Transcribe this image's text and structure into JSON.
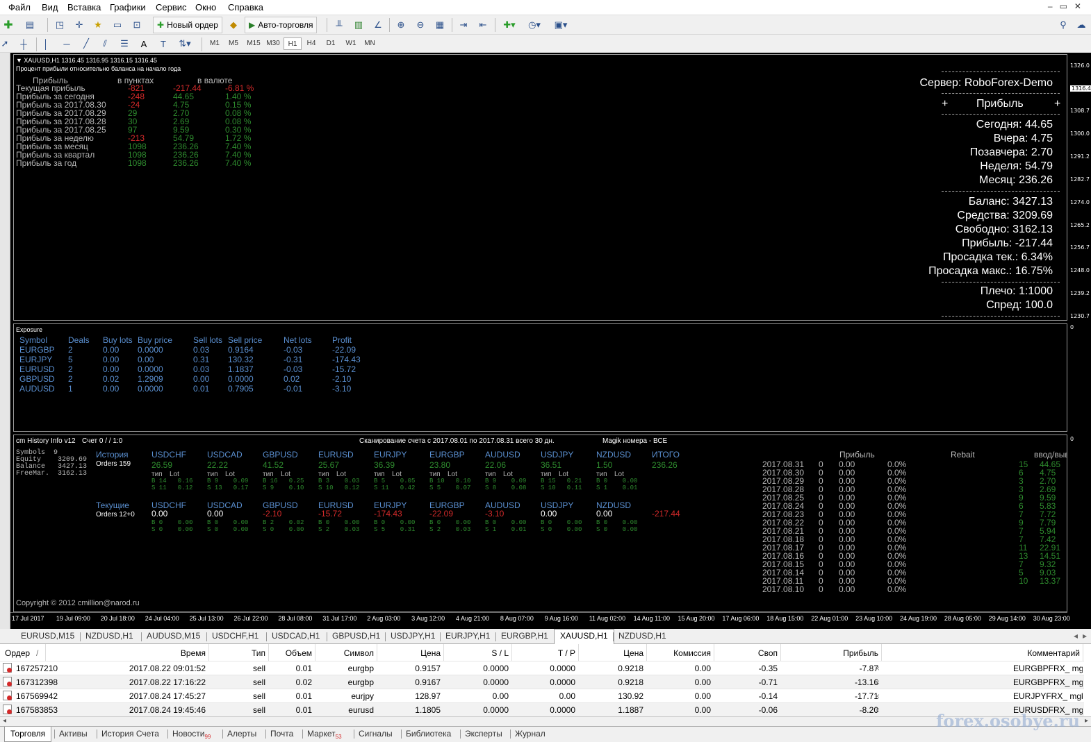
{
  "menu": [
    "Файл",
    "Вид",
    "Вставка",
    "Графики",
    "Сервис",
    "Окно",
    "Справка"
  ],
  "toolbar": {
    "new_order": "Новый ордер",
    "auto_trading": "Авто-торговля",
    "timeframes": [
      "M1",
      "M5",
      "M15",
      "M30",
      "H1",
      "H4",
      "D1",
      "W1",
      "MN"
    ],
    "active_timeframe": "H1"
  },
  "chart": {
    "header": "XAUUSD,H1  1316.45 1316.95 1316.15 1316.45",
    "subheader": "Процент прибыли относительно баланса на начало года",
    "profit_table": {
      "headers": [
        "Прибыль",
        "в пунктах",
        "в валюте"
      ],
      "rows": [
        {
          "label": "Текущая прибыль",
          "points": "-821",
          "money": "-217.44",
          "pct": "-6.81 %",
          "neg": true
        },
        {
          "label": "Прибыль за сегодня",
          "points": "-248",
          "money": "44.65",
          "pct": "1.40 %",
          "neg": false,
          "pneg": true
        },
        {
          "label": "Прибыль за 2017.08.30",
          "points": "-24",
          "money": "4.75",
          "pct": "0.15 %",
          "neg": false,
          "pneg": true
        },
        {
          "label": "Прибыль за 2017.08.29",
          "points": "29",
          "money": "2.70",
          "pct": "0.08 %",
          "neg": false
        },
        {
          "label": "Прибыль за 2017.08.28",
          "points": "30",
          "money": "2.69",
          "pct": "0.08 %",
          "neg": false
        },
        {
          "label": "Прибыль за 2017.08.25",
          "points": "97",
          "money": "9.59",
          "pct": "0.30 %",
          "neg": false
        },
        {
          "label": "Прибыль за неделю",
          "points": "-213",
          "money": "54.79",
          "pct": "1.72 %",
          "neg": false,
          "pneg": true
        },
        {
          "label": "Прибыль за месяц",
          "points": "1098",
          "money": "236.26",
          "pct": "7.40 %",
          "neg": false
        },
        {
          "label": "Прибыль за квартал",
          "points": "1098",
          "money": "236.26",
          "pct": "7.40 %",
          "neg": false
        },
        {
          "label": "Прибыль за год",
          "points": "1098",
          "money": "236.26",
          "pct": "7.40 %",
          "neg": false
        }
      ]
    },
    "right_panel": {
      "server": "Сервер: RoboForex-Demo",
      "profit_header": "Прибыль",
      "plus": "+",
      "lines1": [
        "Сегодня: 44.65",
        "Вчера: 4.75",
        "Позавчера: 2.70",
        "Неделя: 54.79",
        "Месяц: 236.26"
      ],
      "lines2": [
        "Баланс: 3427.13",
        "Средства: 3209.69",
        "Свободно: 3162.13",
        "Прибыль:  -217.44",
        "Просадка тек.:  6.34%",
        "Просадка макс.:  16.75%"
      ],
      "lines3": [
        "Плечо: 1:1000",
        "Спред: 100.0"
      ]
    },
    "price_ticks": [
      "1326.0",
      "1316.4",
      "1308.7",
      "1300.0",
      "1291.2",
      "1282.7",
      "1274.0",
      "1265.2",
      "1256.7",
      "1248.0",
      "1239.2",
      "1230.7",
      "0",
      "0"
    ],
    "time_ticks": [
      "17 Jul 2017",
      "19 Jul 09:00",
      "20 Jul 18:00",
      "24 Jul 04:00",
      "25 Jul 13:00",
      "26 Jul 22:00",
      "28 Jul 08:00",
      "31 Jul 17:00",
      "2 Aug 03:00",
      "3 Aug 12:00",
      "4 Aug 21:00",
      "8 Aug 07:00",
      "9 Aug 16:00",
      "11 Aug 02:00",
      "14 Aug 11:00",
      "15 Aug 20:00",
      "17 Aug 06:00",
      "18 Aug 15:00",
      "22 Aug 01:00",
      "23 Aug 10:00",
      "24 Aug 19:00",
      "28 Aug 05:00",
      "29 Aug 14:00",
      "30 Aug 23:00"
    ]
  },
  "exposure": {
    "title": "Exposure",
    "headers": [
      "Symbol",
      "Deals",
      "Buy lots",
      "Buy price",
      "Sell lots",
      "Sell price",
      "Net lots",
      "Profit"
    ],
    "rows": [
      [
        "EURGBP",
        "2",
        "0.00",
        "0.0000",
        "0.03",
        "0.9164",
        "-0.03",
        "-22.09"
      ],
      [
        "EURJPY",
        "5",
        "0.00",
        "0.00",
        "0.31",
        "130.32",
        "-0.31",
        "-174.43"
      ],
      [
        "EURUSD",
        "2",
        "0.00",
        "0.0000",
        "0.03",
        "1.1837",
        "-0.03",
        "-15.72"
      ],
      [
        "GBPUSD",
        "2",
        "0.02",
        "1.2909",
        "0.00",
        "0.0000",
        "0.02",
        "-2.10"
      ],
      [
        "AUDUSD",
        "1",
        "0.00",
        "0.0000",
        "0.01",
        "0.7905",
        "-0.01",
        "-3.10"
      ]
    ]
  },
  "history": {
    "title": "cm History Info v12",
    "account": "Счет 0 /  / 1:0",
    "scan": "Сканирование счета с 2017.08.01 по 2017.08.31 всего 30 дн.",
    "magic": "Magik номера - ВСЕ",
    "stats": [
      "Symbols  9",
      "Equity    3209.69",
      "Balance   3427.13",
      "FreeMar.  3162.13"
    ],
    "history_label": "История",
    "history_orders": "Orders 159",
    "current_label": "Текущие",
    "current_orders": "Orders 12+0",
    "type_lot": [
      "тип",
      "Lot"
    ],
    "total_label": "ИТОГО",
    "hist_total": "236.26",
    "cur_total": "-217.44",
    "pairs": [
      {
        "sym": "USDCHF",
        "hp": "26.59",
        "hb": "B 14   0.16",
        "hs": "S 11   0.12",
        "cp": "0.00",
        "cneg": false,
        "cb": "B 0    0.00",
        "cs": "S 0    0.00"
      },
      {
        "sym": "USDCAD",
        "hp": "22.22",
        "hb": "B 9    0.09",
        "hs": "S 13   0.17",
        "cp": "0.00",
        "cneg": false,
        "cb": "B 0    0.00",
        "cs": "S 0    0.00"
      },
      {
        "sym": "GBPUSD",
        "hp": "41.52",
        "hb": "B 16   0.25",
        "hs": "S 9    0.10",
        "cp": "-2.10",
        "cneg": true,
        "cb": "B 2    0.02",
        "cs": "S 0    0.00"
      },
      {
        "sym": "EURUSD",
        "hp": "25.67",
        "hb": "B 3    0.03",
        "hs": "S 10   0.12",
        "cp": "-15.72",
        "cneg": true,
        "cb": "B 0    0.00",
        "cs": "S 2    0.03"
      },
      {
        "sym": "EURJPY",
        "hp": "36.39",
        "hb": "B 5    0.05",
        "hs": "S 11   0.42",
        "cp": "-174.43",
        "cneg": true,
        "cb": "B 0    0.00",
        "cs": "S 5    0.31"
      },
      {
        "sym": "EURGBP",
        "hp": "23.80",
        "hb": "B 10   0.10",
        "hs": "S 5    0.07",
        "cp": "-22.09",
        "cneg": true,
        "cb": "B 0    0.00",
        "cs": "S 2    0.03"
      },
      {
        "sym": "AUDUSD",
        "hp": "22.06",
        "hb": "B 9    0.09",
        "hs": "S 8    0.08",
        "cp": "-3.10",
        "cneg": true,
        "cb": "B 0    0.00",
        "cs": "S 1    0.01"
      },
      {
        "sym": "USDJPY",
        "hp": "36.51",
        "hb": "B 15   0.21",
        "hs": "S 10   0.11",
        "cp": "0.00",
        "cneg": false,
        "cb": "B 0    0.00",
        "cs": "S 0    0.00"
      },
      {
        "sym": "NZDUSD",
        "hp": "1.50",
        "hb": "B 0    0.00",
        "hs": "S 1    0.01",
        "cp": "0.00",
        "cneg": false,
        "cb": "B 0    0.00",
        "cs": "S 0    0.00"
      }
    ],
    "daily_headers": [
      "Прибыль",
      "Rebait",
      "ввод/вывод"
    ],
    "daily": [
      [
        "2017.08.31",
        "0",
        "0.00",
        "0.0%",
        "15",
        "44.65"
      ],
      [
        "2017.08.30",
        "0",
        "0.00",
        "0.0%",
        "6",
        "4.75"
      ],
      [
        "2017.08.29",
        "0",
        "0.00",
        "0.0%",
        "3",
        "2.70"
      ],
      [
        "2017.08.28",
        "0",
        "0.00",
        "0.0%",
        "3",
        "2.69"
      ],
      [
        "2017.08.25",
        "0",
        "0.00",
        "0.0%",
        "9",
        "9.59"
      ],
      [
        "2017.08.24",
        "0",
        "0.00",
        "0.0%",
        "6",
        "5.83"
      ],
      [
        "2017.08.23",
        "0",
        "0.00",
        "0.0%",
        "7",
        "7.72"
      ],
      [
        "2017.08.22",
        "0",
        "0.00",
        "0.0%",
        "9",
        "7.79"
      ],
      [
        "2017.08.21",
        "0",
        "0.00",
        "0.0%",
        "7",
        "5.94"
      ],
      [
        "2017.08.18",
        "0",
        "0.00",
        "0.0%",
        "7",
        "7.42"
      ],
      [
        "2017.08.17",
        "0",
        "0.00",
        "0.0%",
        "11",
        "22.91"
      ],
      [
        "2017.08.16",
        "0",
        "0.00",
        "0.0%",
        "13",
        "14.51"
      ],
      [
        "2017.08.15",
        "0",
        "0.00",
        "0.0%",
        "7",
        "9.32"
      ],
      [
        "2017.08.14",
        "0",
        "0.00",
        "0.0%",
        "5",
        "9.03"
      ],
      [
        "2017.08.11",
        "0",
        "0.00",
        "0.0%",
        "10",
        "13.37"
      ],
      [
        "2017.08.10",
        "0",
        "0.00",
        "0.0%",
        "",
        ""
      ]
    ],
    "copyright": "Copyright © 2012 cmillion@narod.ru"
  },
  "chart_tabs": [
    "EURUSD,M15",
    "NZDUSD,H1",
    "AUDUSD,M15",
    "USDCHF,H1",
    "USDCAD,H1",
    "GBPUSD,H1",
    "USDJPY,H1",
    "EURJPY,H1",
    "EURGBP,H1",
    "XAUUSD,H1",
    "NZDUSD,H1"
  ],
  "active_chart_tab": "XAUUSD,H1",
  "terminal": {
    "headers": [
      "Ордер",
      "Время",
      "Тип",
      "Объем",
      "Символ",
      "Цена",
      "S / L",
      "T / P",
      "Цена",
      "Комиссия",
      "Своп",
      "Прибыль",
      "Комментарий"
    ],
    "sort_mark": "/",
    "orders": [
      [
        "167257210",
        "2017.08.22 09:01:52",
        "sell",
        "0.01",
        "eurgbp",
        "0.9157",
        "0.0000",
        "0.0000",
        "0.9218",
        "0.00",
        "-0.35",
        "-7.87",
        "EURGBPFRX_ mgk999"
      ],
      [
        "167312398",
        "2017.08.22 17:16:22",
        "sell",
        "0.02",
        "eurgbp",
        "0.9167",
        "0.0000",
        "0.0000",
        "0.9218",
        "0.00",
        "-0.71",
        "-13.16",
        "EURGBPFRX_ mgk999"
      ],
      [
        "167569942",
        "2017.08.24 17:45:27",
        "sell",
        "0.01",
        "eurjpy",
        "128.97",
        "0.00",
        "0.00",
        "130.92",
        "0.00",
        "-0.14",
        "-17.71",
        "EURJPYFRX_ mgk999"
      ],
      [
        "167583853",
        "2017.08.24 19:45:46",
        "sell",
        "0.01",
        "eurusd",
        "1.1805",
        "0.0000",
        "0.0000",
        "1.1887",
        "0.00",
        "-0.06",
        "-8.20",
        "EURUSDFRX_ mgk999"
      ]
    ]
  },
  "bottom_tabs": [
    {
      "label": "Торговля",
      "badge": ""
    },
    {
      "label": "Активы",
      "badge": ""
    },
    {
      "label": "История Счета",
      "badge": ""
    },
    {
      "label": "Новости",
      "badge": "99"
    },
    {
      "label": "Алерты",
      "badge": ""
    },
    {
      "label": "Почта",
      "badge": ""
    },
    {
      "label": "Маркет",
      "badge": "53"
    },
    {
      "label": "Сигналы",
      "badge": ""
    },
    {
      "label": "Библиотека",
      "badge": ""
    },
    {
      "label": "Эксперты",
      "badge": ""
    },
    {
      "label": "Журнал",
      "badge": ""
    }
  ],
  "watermark": "forex.osobye.ru",
  "colors": {
    "positive": "#2e8b2e",
    "negative": "#d42a2a",
    "label_blue": "#5a8fd0",
    "chart_bg": "#000000"
  }
}
